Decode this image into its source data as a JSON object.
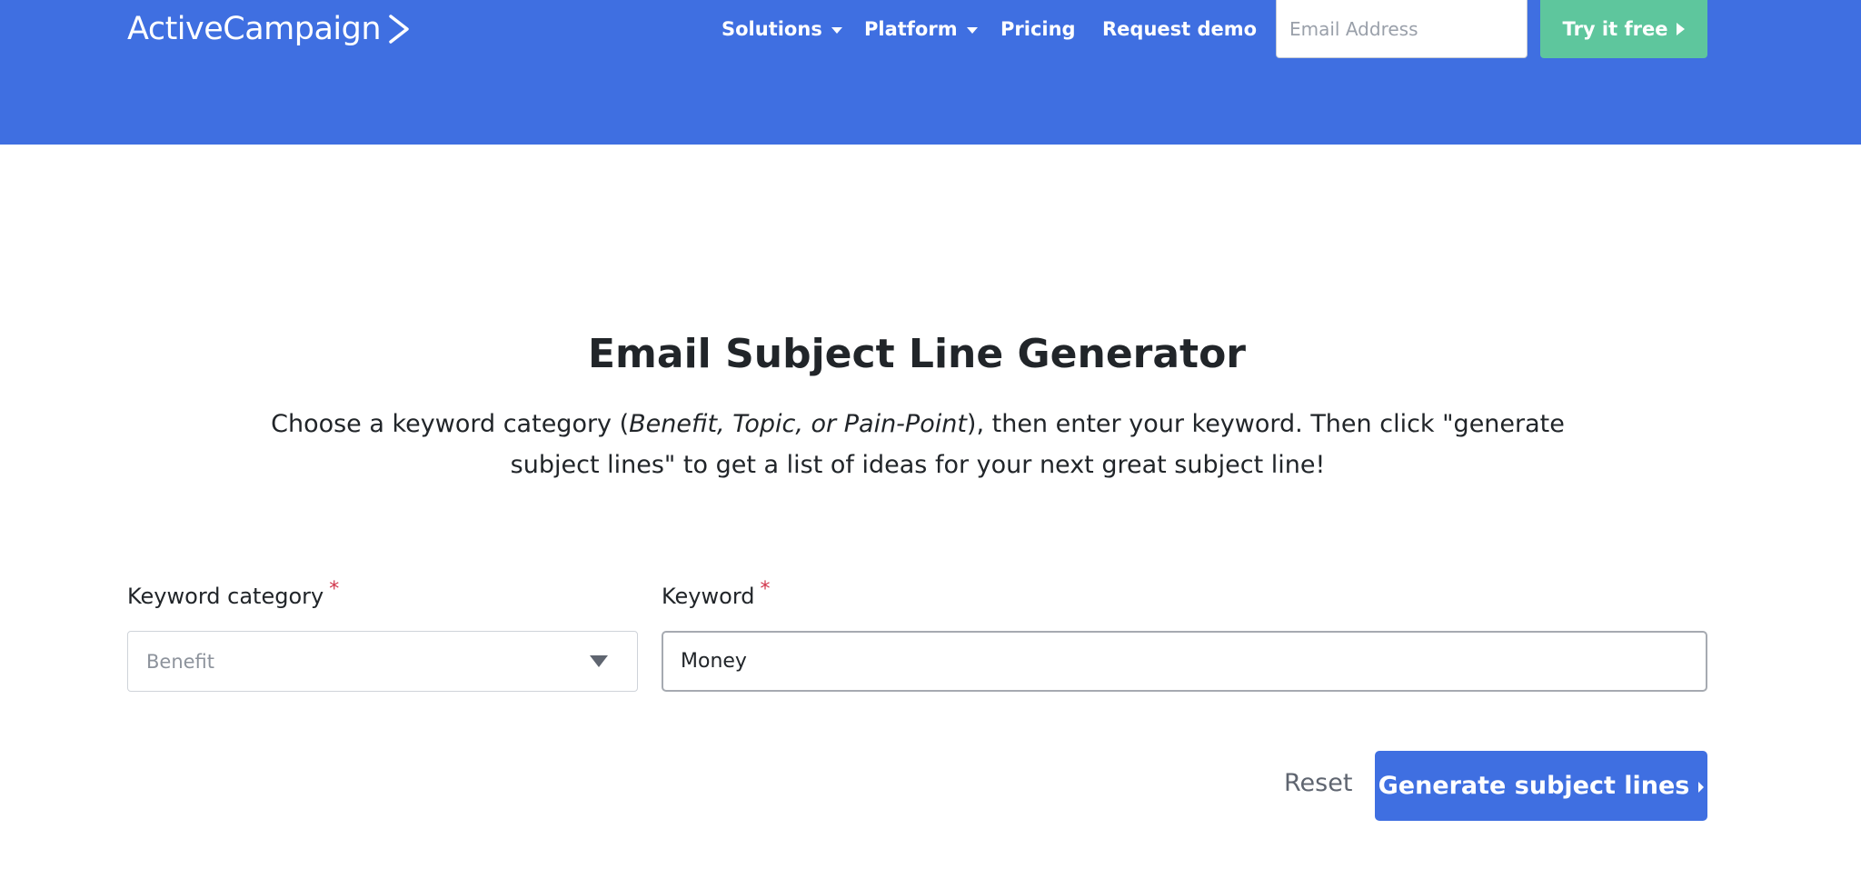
{
  "header": {
    "logo_text": "ActiveCampaign",
    "nav": {
      "solutions": "Solutions",
      "platform": "Platform",
      "pricing": "Pricing",
      "request_demo": "Request demo"
    },
    "email_placeholder": "Email Address",
    "try_label": "Try it free"
  },
  "main": {
    "title": "Email Subject Line Generator",
    "description": {
      "before": "Choose a keyword category (",
      "italic": "Benefit, Topic, or Pain-Point",
      "after": "), then enter your keyword. Then click \"generate subject lines\" to get a list of ideas for your next great subject line!"
    },
    "form": {
      "category_label": "Keyword category",
      "keyword_label": "Keyword",
      "required_mark": "*",
      "category_value": "Benefit",
      "keyword_value": "Money",
      "reset_label": "Reset",
      "generate_label": "Generate subject lines"
    }
  },
  "colors": {
    "brand_blue": "#3f6fe1",
    "cta_green": "#5ec69d",
    "required_red": "#d1354b"
  },
  "icons": [
    "chevron-logo-icon",
    "caret-down-icon",
    "caret-right-icon"
  ]
}
